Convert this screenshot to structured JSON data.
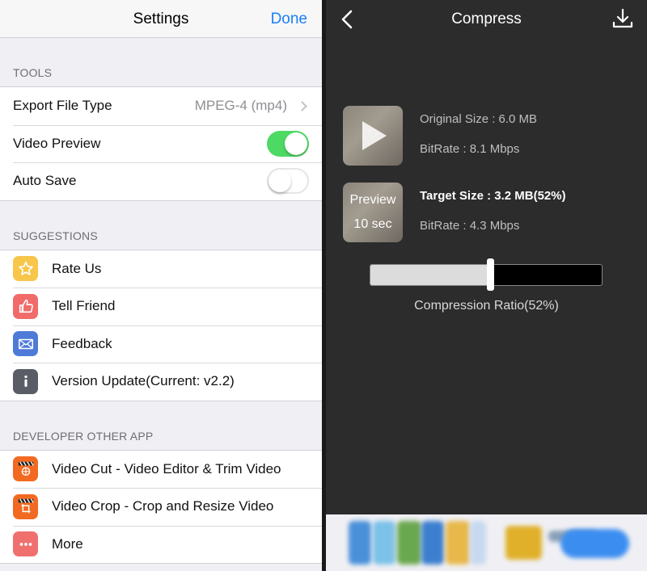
{
  "settings": {
    "title": "Settings",
    "done_label": "Done",
    "tools": {
      "header": "TOOLS",
      "export_label": "Export File Type",
      "export_value": "MPEG-4 (mp4)",
      "preview_label": "Video Preview",
      "preview_on": true,
      "autosave_label": "Auto Save",
      "autosave_on": false
    },
    "suggestions": {
      "header": "SUGGESTIONS",
      "items": [
        {
          "label": "Rate Us",
          "icon": "star-icon",
          "color": "#f7c64a"
        },
        {
          "label": "Tell Friend",
          "icon": "thumbs-up-icon",
          "color": "#f16b6b"
        },
        {
          "label": "Feedback",
          "icon": "mail-icon",
          "color": "#4e7bd8"
        },
        {
          "label": "Version Update(Current: v2.2)",
          "icon": "info-icon",
          "color": "#5a5d66"
        }
      ]
    },
    "developer": {
      "header": "DEVELOPER OTHER APP",
      "items": [
        {
          "label": "Video Cut - Video Editor & Trim Video",
          "icon": "clapper-cut-icon",
          "color": "#f26a22"
        },
        {
          "label": "Video Crop - Crop and Resize Video",
          "icon": "clapper-crop-icon",
          "color": "#f26a22"
        },
        {
          "label": "More",
          "icon": "more-icon",
          "color": "#f07070"
        }
      ]
    }
  },
  "compress": {
    "title": "Compress",
    "original_size": "Original Size : 6.0 MB",
    "original_bitrate": "BitRate : 8.1 Mbps",
    "preview_line1": "Preview",
    "preview_line2": "10 sec",
    "target_size": "Target Size : 3.2 MB(52%)",
    "target_bitrate": "BitRate : 4.3 Mbps",
    "ratio_label": "Compression Ratio(52%)",
    "ratio_value": 0.52
  },
  "colors": {
    "accent": "#1a7ff6",
    "toggle_on": "#4cd964",
    "dark_bg": "#2c2c2c"
  }
}
